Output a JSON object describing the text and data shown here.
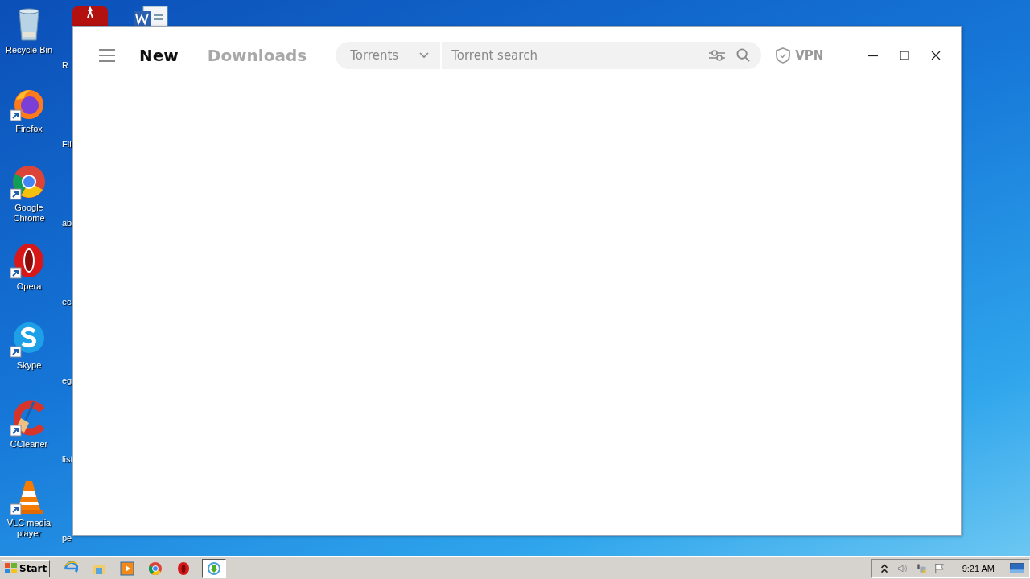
{
  "desktop": {
    "icons": [
      {
        "label": "Recycle Bin",
        "kind": "recycle"
      },
      {
        "label": "Firefox",
        "kind": "firefox"
      },
      {
        "label": "Google Chrome",
        "kind": "chrome"
      },
      {
        "label": "Opera",
        "kind": "opera"
      },
      {
        "label": "Skype",
        "kind": "skype"
      },
      {
        "label": "CCleaner",
        "kind": "ccleaner"
      },
      {
        "label": "VLC media player",
        "kind": "vlc"
      }
    ],
    "hidden_column_labels": [
      "R",
      "Fil",
      "ab",
      "ec",
      "eg",
      "list",
      "pe"
    ]
  },
  "window": {
    "tabs": [
      {
        "label": "New",
        "selected": true
      },
      {
        "label": "Downloads",
        "selected": false
      }
    ],
    "search": {
      "category": "Torrents",
      "placeholder": "Torrent search"
    },
    "vpn": "VPN"
  },
  "taskbar": {
    "start": "Start",
    "apps": [
      {
        "kind": "ie",
        "active": false
      },
      {
        "kind": "explorer",
        "active": false
      },
      {
        "kind": "media",
        "active": false
      },
      {
        "kind": "chrome",
        "active": false
      },
      {
        "kind": "opera",
        "active": false
      },
      {
        "kind": "download",
        "active": true
      }
    ],
    "clock": "9:21 AM"
  }
}
